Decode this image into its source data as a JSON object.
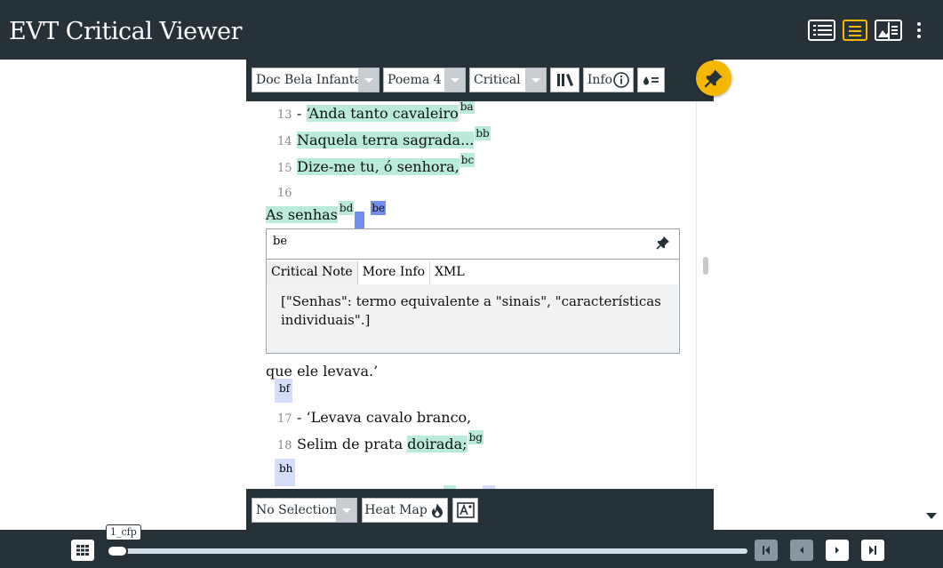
{
  "app": {
    "title": "EVT Critical Viewer"
  },
  "top_icons": [
    "list-view-icon",
    "text-view-icon",
    "image-text-view-icon",
    "kebab-menu-icon"
  ],
  "panel": {
    "document_select": "Doc Bela Infanta",
    "poem_select": "Poema 4",
    "edition_select": "Critical",
    "info_label": "Info",
    "lines": [
      {
        "n": "13",
        "prefix": "- ",
        "text": "‘Anda tanto cavaleiro",
        "app": "ba"
      },
      {
        "n": "14",
        "prefix": "",
        "text": "Naquela terra sagrada...",
        "app": "bb"
      },
      {
        "n": "15",
        "prefix": "",
        "text": "Dize-me tu, ó senhora,",
        "app": "bc"
      },
      {
        "n": "16",
        "prefix": "",
        "text": "",
        "app": ""
      }
    ],
    "senhas_text": "As senhas",
    "senhas_app": "bd",
    "selected_app": "be",
    "note": {
      "ref": "be",
      "tabs": [
        "Critical Note",
        "More Info",
        "XML"
      ],
      "body": "[\"Senhas\": termo equivalente a \"sinais\", \"características individuais\".]"
    },
    "after_text": "que ele levava.’",
    "after_app": "bf",
    "lines2": [
      {
        "n": "17",
        "prefix": "- ",
        "text": "‘Levava cavalo branco,"
      },
      {
        "n": "18",
        "prefix": "",
        "text": "Selim de prata ",
        "hl_text": "doirada;",
        "app": "bg"
      }
    ],
    "trailing_app": "bh",
    "footer": {
      "selection_select": "No Selection",
      "heatmap_label": "Heat Map"
    }
  },
  "navigation": {
    "page_label": "1_cfp"
  },
  "colors": {
    "dark": "#263238",
    "accent": "#f5b800",
    "app_highlight": "#b9eadb",
    "selected_app": "#6f8ef0"
  }
}
